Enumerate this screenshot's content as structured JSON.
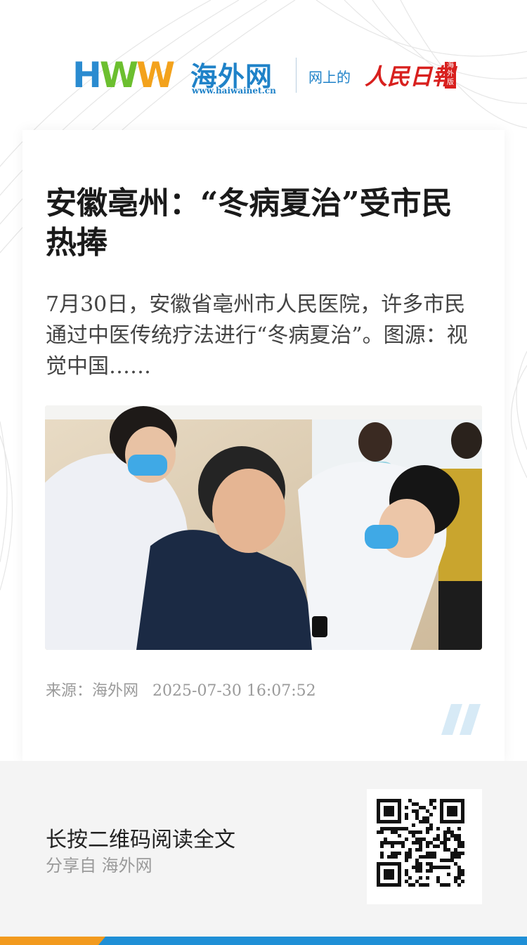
{
  "header": {
    "logo_letters": [
      "H",
      "W",
      "W"
    ],
    "logo_colors": [
      "#2a8bd0",
      "#6cbf2f",
      "#f3a21c"
    ],
    "site_name_cn": "海外网",
    "site_url": "www.haiwainet.cn",
    "online_label": "网上的",
    "rmrb_name": "人民日報",
    "rmrb_edition": "海外版"
  },
  "article": {
    "title": "安徽亳州：“冬病夏治”受市民热捧",
    "summary": "7月30日，安徽省亳州市人民医院，许多市民通过中医传统疗法进行“冬病夏治”。图源：视觉中国……",
    "image_alt": "doctors treating elderly man",
    "source": "来源：海外网",
    "datetime": "2025-07-30 16:07:52"
  },
  "footer": {
    "cta": "长按二维码阅读全文",
    "share_from": "分享自 海外网",
    "qr_icon": "qr-code-icon"
  },
  "colors": {
    "brand_blue": "#1f8fd6",
    "brand_orange": "#f29a1e",
    "rmrb_red": "#d8201e"
  }
}
